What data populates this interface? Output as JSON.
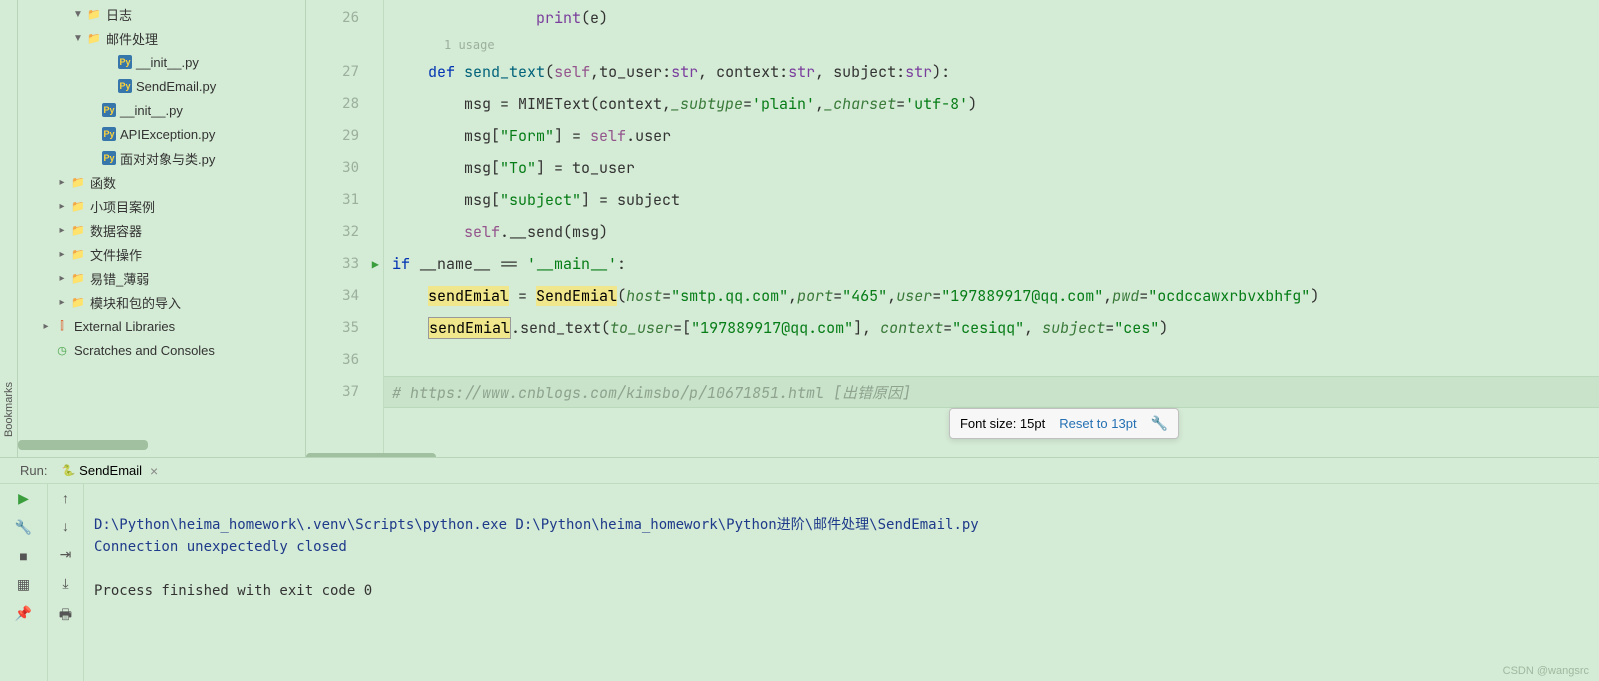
{
  "sidebarStrip": {
    "label": "Bookmarks"
  },
  "tree": {
    "items": [
      {
        "indent": 44,
        "arrow": "▼",
        "icon": "folder",
        "label": "日志"
      },
      {
        "indent": 44,
        "arrow": "▼",
        "icon": "folder",
        "label": "邮件处理"
      },
      {
        "indent": 76,
        "arrow": "",
        "icon": "py",
        "label": "__init__.py"
      },
      {
        "indent": 76,
        "arrow": "",
        "icon": "py",
        "label": "SendEmail.py"
      },
      {
        "indent": 60,
        "arrow": "",
        "icon": "py",
        "label": "__init__.py"
      },
      {
        "indent": 60,
        "arrow": "",
        "icon": "py",
        "label": "APIException.py"
      },
      {
        "indent": 60,
        "arrow": "",
        "icon": "py",
        "label": "面对对象与类.py"
      },
      {
        "indent": 28,
        "arrow": "▸",
        "icon": "folder",
        "label": "函数"
      },
      {
        "indent": 28,
        "arrow": "▸",
        "icon": "folder",
        "label": "小项目案例"
      },
      {
        "indent": 28,
        "arrow": "▸",
        "icon": "folder",
        "label": "数据容器"
      },
      {
        "indent": 28,
        "arrow": "▸",
        "icon": "folder",
        "label": "文件操作"
      },
      {
        "indent": 28,
        "arrow": "▸",
        "icon": "folder",
        "label": "易错_薄弱"
      },
      {
        "indent": 28,
        "arrow": "▸",
        "icon": "folder",
        "label": "模块和包的导入"
      },
      {
        "indent": 12,
        "arrow": "▸",
        "icon": "lib",
        "label": "External Libraries"
      },
      {
        "indent": 12,
        "arrow": "",
        "icon": "scratch",
        "label": "Scratches and Consoles"
      }
    ]
  },
  "editor": {
    "usageHint": "1 usage",
    "lines": [
      {
        "num": "26",
        "segments": [
          {
            "txt": "                ",
            "cls": ""
          },
          {
            "txt": "print",
            "cls": "builtin"
          },
          {
            "txt": "(e)",
            "cls": "ident"
          }
        ]
      },
      {
        "num": "27",
        "segments": [
          {
            "txt": "    ",
            "cls": ""
          },
          {
            "txt": "def ",
            "cls": "kw"
          },
          {
            "txt": "send_text",
            "cls": "fn"
          },
          {
            "txt": "(",
            "cls": "op"
          },
          {
            "txt": "self",
            "cls": "self"
          },
          {
            "txt": ",to_user:",
            "cls": "ident"
          },
          {
            "txt": "str",
            "cls": "builtin"
          },
          {
            "txt": ", context:",
            "cls": "ident"
          },
          {
            "txt": "str",
            "cls": "builtin"
          },
          {
            "txt": ", subject:",
            "cls": "ident"
          },
          {
            "txt": "str",
            "cls": "builtin"
          },
          {
            "txt": "):",
            "cls": "op"
          }
        ]
      },
      {
        "num": "28",
        "segments": [
          {
            "txt": "        msg = MIMEText(context,",
            "cls": "ident"
          },
          {
            "txt": "_subtype",
            "cls": "param"
          },
          {
            "txt": "=",
            "cls": "op"
          },
          {
            "txt": "'plain'",
            "cls": "str"
          },
          {
            "txt": ",",
            "cls": "op"
          },
          {
            "txt": "_charset",
            "cls": "param"
          },
          {
            "txt": "=",
            "cls": "op"
          },
          {
            "txt": "'utf-8'",
            "cls": "str"
          },
          {
            "txt": ")",
            "cls": "op"
          }
        ]
      },
      {
        "num": "29",
        "segments": [
          {
            "txt": "        msg[",
            "cls": "ident"
          },
          {
            "txt": "\"Form\"",
            "cls": "str"
          },
          {
            "txt": "] = ",
            "cls": "op"
          },
          {
            "txt": "self",
            "cls": "self"
          },
          {
            "txt": ".user",
            "cls": "ident"
          }
        ]
      },
      {
        "num": "30",
        "segments": [
          {
            "txt": "        msg[",
            "cls": "ident"
          },
          {
            "txt": "\"To\"",
            "cls": "str"
          },
          {
            "txt": "] = to_user",
            "cls": "ident"
          }
        ]
      },
      {
        "num": "31",
        "segments": [
          {
            "txt": "        msg[",
            "cls": "ident"
          },
          {
            "txt": "\"subject\"",
            "cls": "str"
          },
          {
            "txt": "] = subject",
            "cls": "ident"
          }
        ]
      },
      {
        "num": "32",
        "segments": [
          {
            "txt": "        ",
            "cls": ""
          },
          {
            "txt": "self",
            "cls": "self"
          },
          {
            "txt": ".__send(msg)",
            "cls": "ident"
          }
        ]
      },
      {
        "num": "33",
        "run": true,
        "segments": [
          {
            "txt": "if ",
            "cls": "kw"
          },
          {
            "txt": "__name__ == ",
            "cls": "ident"
          },
          {
            "txt": "'__main__'",
            "cls": "str"
          },
          {
            "txt": ":",
            "cls": "op"
          }
        ]
      },
      {
        "num": "34",
        "segments": [
          {
            "txt": "    ",
            "cls": ""
          },
          {
            "txt": "sendEmial",
            "cls": "hl"
          },
          {
            "txt": " = ",
            "cls": "op"
          },
          {
            "txt": "SendEmial",
            "cls": "hl"
          },
          {
            "txt": "(",
            "cls": "op"
          },
          {
            "txt": "host",
            "cls": "param"
          },
          {
            "txt": "=",
            "cls": "op"
          },
          {
            "txt": "\"smtp.qq.com\"",
            "cls": "str"
          },
          {
            "txt": ",",
            "cls": "op"
          },
          {
            "txt": "port",
            "cls": "param"
          },
          {
            "txt": "=",
            "cls": "op"
          },
          {
            "txt": "\"465\"",
            "cls": "str"
          },
          {
            "txt": ",",
            "cls": "op"
          },
          {
            "txt": "user",
            "cls": "param"
          },
          {
            "txt": "=",
            "cls": "op"
          },
          {
            "txt": "\"197889917@qq.com\"",
            "cls": "str"
          },
          {
            "txt": ",",
            "cls": "op"
          },
          {
            "txt": "pwd",
            "cls": "param"
          },
          {
            "txt": "=",
            "cls": "op"
          },
          {
            "txt": "\"ocdccawxrbvxbhfg\"",
            "cls": "str"
          },
          {
            "txt": ")",
            "cls": "op"
          }
        ]
      },
      {
        "num": "35",
        "segments": [
          {
            "txt": "    ",
            "cls": ""
          },
          {
            "txt": "sendEmial",
            "cls": "hl-box"
          },
          {
            "txt": ".send_text(",
            "cls": "ident"
          },
          {
            "txt": "to_user",
            "cls": "param"
          },
          {
            "txt": "=[",
            "cls": "op"
          },
          {
            "txt": "\"197889917@qq.com\"",
            "cls": "str"
          },
          {
            "txt": "], ",
            "cls": "op"
          },
          {
            "txt": "context",
            "cls": "param"
          },
          {
            "txt": "=",
            "cls": "op"
          },
          {
            "txt": "\"cesiqq\"",
            "cls": "str"
          },
          {
            "txt": ", ",
            "cls": "op"
          },
          {
            "txt": "subject",
            "cls": "param"
          },
          {
            "txt": "=",
            "cls": "op"
          },
          {
            "txt": "\"ces\"",
            "cls": "str"
          },
          {
            "txt": ")",
            "cls": "op"
          }
        ]
      },
      {
        "num": "36",
        "segments": [
          {
            "txt": "",
            "cls": ""
          }
        ]
      },
      {
        "num": "37",
        "current": true,
        "segments": [
          {
            "txt": "# https://www.cnblogs.com/kimsbo/p/10671851.html [出错原因]",
            "cls": "comment"
          }
        ]
      }
    ],
    "fontPopup": {
      "text": "Font size: 15pt",
      "link": "Reset to 13pt"
    }
  },
  "runPanel": {
    "label": "Run:",
    "tabName": "SendEmail",
    "output": {
      "path": "D:\\Python\\heima_homework\\.venv\\Scripts\\python.exe D:\\Python\\heima_homework\\Python进阶\\邮件处理\\SendEmail.py",
      "error": "Connection unexpectedly closed",
      "finish": "Process finished with exit code 0"
    }
  },
  "watermark": "CSDN @wangsrc"
}
